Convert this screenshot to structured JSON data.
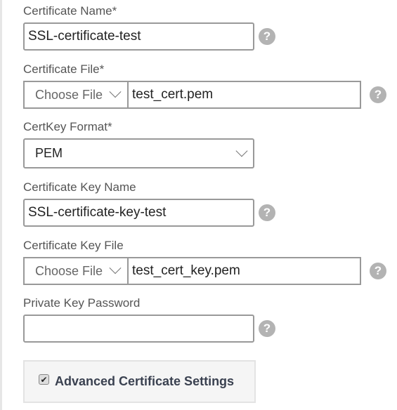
{
  "form": {
    "certificate_name": {
      "label": "Certificate Name*",
      "value": "SSL-certificate-test"
    },
    "certificate_file": {
      "label": "Certificate File*",
      "choose_label": "Choose File",
      "filename": "test_cert.pem"
    },
    "certkey_format": {
      "label": "CertKey Format*",
      "selected": "PEM"
    },
    "certificate_key_name": {
      "label": "Certificate Key Name",
      "value": "SSL-certificate-key-test"
    },
    "certificate_key_file": {
      "label": "Certificate Key File",
      "choose_label": "Choose File",
      "filename": "test_cert_key.pem"
    },
    "private_key_password": {
      "label": "Private Key Password",
      "value": ""
    },
    "advanced": {
      "label": "Advanced Certificate Settings",
      "checked": true,
      "check_glyph": "✔"
    }
  },
  "help_glyph": "?"
}
